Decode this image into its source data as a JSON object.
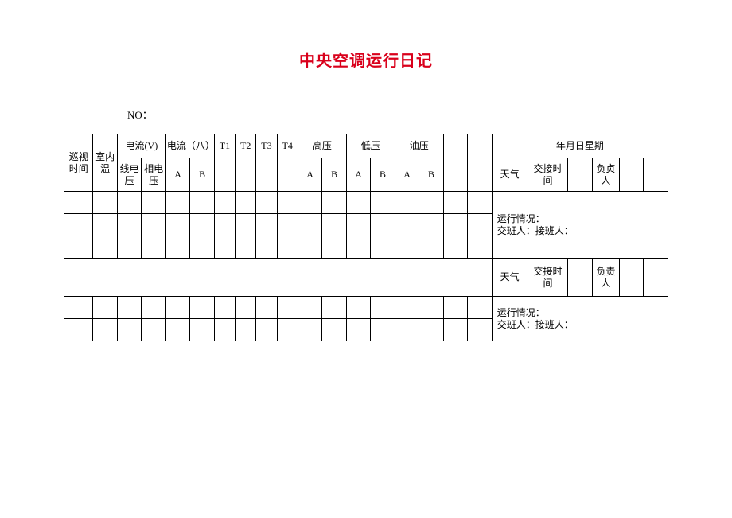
{
  "title": "中央空调运行日记",
  "no_label": "NO：",
  "headers": {
    "patrol_time": "巡视时间",
    "room_temp": "室内温",
    "current_v": "电流(V)",
    "current_a": "电流（八）",
    "t1": "T1",
    "t2": "T2",
    "t3": "T3",
    "t4": "T4",
    "high_pressure": "高压",
    "low_pressure": "低压",
    "oil_pressure": "油压",
    "date_week": "年月日星期",
    "line_voltage": "线电压",
    "phase_voltage": "相电压",
    "A": "A",
    "B": "B",
    "weather": "天气",
    "handover_time": "交接时间",
    "responsible": "负责人",
    "responsible_alt": "负贞人"
  },
  "summary": {
    "run_status": "运行情况：",
    "handover_people": "交班人：接班人："
  }
}
